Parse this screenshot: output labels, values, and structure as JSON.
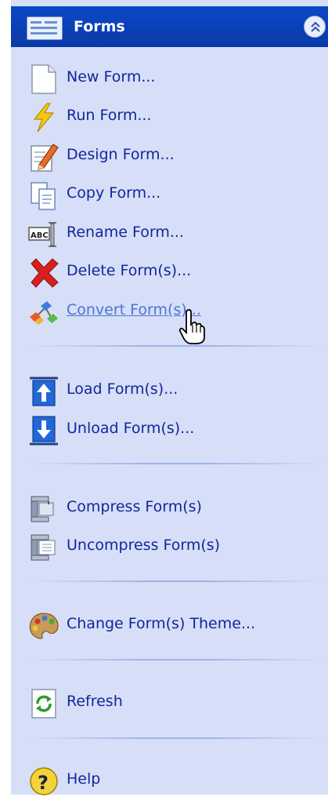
{
  "panel": {
    "title": "Forms",
    "icons": {
      "header": "forms-panel-icon",
      "collapse": "double-chevron-up-icon"
    }
  },
  "items": [
    {
      "label": "New Form...",
      "icon": "blank-page-icon"
    },
    {
      "label": "Run Form...",
      "icon": "lightning-icon"
    },
    {
      "label": "Design Form...",
      "icon": "pencil-page-icon"
    },
    {
      "label": "Copy Form...",
      "icon": "copy-pages-icon"
    },
    {
      "label": "Rename Form...",
      "icon": "abc-rename-icon"
    },
    {
      "label": "Delete Form(s)...",
      "icon": "red-x-icon"
    },
    {
      "label": "Convert Form(s)...",
      "icon": "convert-icon",
      "state": "hovered"
    },
    {
      "label": "Load Form(s)...",
      "icon": "load-up-icon"
    },
    {
      "label": "Unload Form(s)...",
      "icon": "unload-down-icon"
    },
    {
      "label": "Compress Form(s)",
      "icon": "compress-clamp-icon"
    },
    {
      "label": "Uncompress Form(s)",
      "icon": "uncompress-clamp-icon"
    },
    {
      "label": "Change Form(s) Theme...",
      "icon": "palette-icon"
    },
    {
      "label": "Refresh",
      "icon": "refresh-icon"
    },
    {
      "label": "Help",
      "icon": "help-question-icon"
    }
  ],
  "colors": {
    "header": "#0a3aa8",
    "panel_bg": "#d6dff7",
    "link_text": "#14259c",
    "hover_text": "#4c74d8"
  }
}
